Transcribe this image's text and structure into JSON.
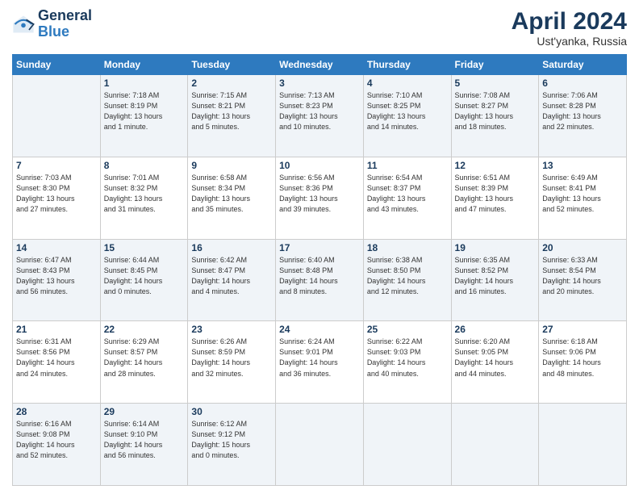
{
  "logo": {
    "line1": "General",
    "line2": "Blue"
  },
  "title": {
    "main": "April 2024",
    "sub": "Ust'yanka, Russia"
  },
  "days_of_week": [
    "Sunday",
    "Monday",
    "Tuesday",
    "Wednesday",
    "Thursday",
    "Friday",
    "Saturday"
  ],
  "weeks": [
    [
      {
        "day": "",
        "info": ""
      },
      {
        "day": "1",
        "info": "Sunrise: 7:18 AM\nSunset: 8:19 PM\nDaylight: 13 hours\nand 1 minute."
      },
      {
        "day": "2",
        "info": "Sunrise: 7:15 AM\nSunset: 8:21 PM\nDaylight: 13 hours\nand 5 minutes."
      },
      {
        "day": "3",
        "info": "Sunrise: 7:13 AM\nSunset: 8:23 PM\nDaylight: 13 hours\nand 10 minutes."
      },
      {
        "day": "4",
        "info": "Sunrise: 7:10 AM\nSunset: 8:25 PM\nDaylight: 13 hours\nand 14 minutes."
      },
      {
        "day": "5",
        "info": "Sunrise: 7:08 AM\nSunset: 8:27 PM\nDaylight: 13 hours\nand 18 minutes."
      },
      {
        "day": "6",
        "info": "Sunrise: 7:06 AM\nSunset: 8:28 PM\nDaylight: 13 hours\nand 22 minutes."
      }
    ],
    [
      {
        "day": "7",
        "info": "Sunrise: 7:03 AM\nSunset: 8:30 PM\nDaylight: 13 hours\nand 27 minutes."
      },
      {
        "day": "8",
        "info": "Sunrise: 7:01 AM\nSunset: 8:32 PM\nDaylight: 13 hours\nand 31 minutes."
      },
      {
        "day": "9",
        "info": "Sunrise: 6:58 AM\nSunset: 8:34 PM\nDaylight: 13 hours\nand 35 minutes."
      },
      {
        "day": "10",
        "info": "Sunrise: 6:56 AM\nSunset: 8:36 PM\nDaylight: 13 hours\nand 39 minutes."
      },
      {
        "day": "11",
        "info": "Sunrise: 6:54 AM\nSunset: 8:37 PM\nDaylight: 13 hours\nand 43 minutes."
      },
      {
        "day": "12",
        "info": "Sunrise: 6:51 AM\nSunset: 8:39 PM\nDaylight: 13 hours\nand 47 minutes."
      },
      {
        "day": "13",
        "info": "Sunrise: 6:49 AM\nSunset: 8:41 PM\nDaylight: 13 hours\nand 52 minutes."
      }
    ],
    [
      {
        "day": "14",
        "info": "Sunrise: 6:47 AM\nSunset: 8:43 PM\nDaylight: 13 hours\nand 56 minutes."
      },
      {
        "day": "15",
        "info": "Sunrise: 6:44 AM\nSunset: 8:45 PM\nDaylight: 14 hours\nand 0 minutes."
      },
      {
        "day": "16",
        "info": "Sunrise: 6:42 AM\nSunset: 8:47 PM\nDaylight: 14 hours\nand 4 minutes."
      },
      {
        "day": "17",
        "info": "Sunrise: 6:40 AM\nSunset: 8:48 PM\nDaylight: 14 hours\nand 8 minutes."
      },
      {
        "day": "18",
        "info": "Sunrise: 6:38 AM\nSunset: 8:50 PM\nDaylight: 14 hours\nand 12 minutes."
      },
      {
        "day": "19",
        "info": "Sunrise: 6:35 AM\nSunset: 8:52 PM\nDaylight: 14 hours\nand 16 minutes."
      },
      {
        "day": "20",
        "info": "Sunrise: 6:33 AM\nSunset: 8:54 PM\nDaylight: 14 hours\nand 20 minutes."
      }
    ],
    [
      {
        "day": "21",
        "info": "Sunrise: 6:31 AM\nSunset: 8:56 PM\nDaylight: 14 hours\nand 24 minutes."
      },
      {
        "day": "22",
        "info": "Sunrise: 6:29 AM\nSunset: 8:57 PM\nDaylight: 14 hours\nand 28 minutes."
      },
      {
        "day": "23",
        "info": "Sunrise: 6:26 AM\nSunset: 8:59 PM\nDaylight: 14 hours\nand 32 minutes."
      },
      {
        "day": "24",
        "info": "Sunrise: 6:24 AM\nSunset: 9:01 PM\nDaylight: 14 hours\nand 36 minutes."
      },
      {
        "day": "25",
        "info": "Sunrise: 6:22 AM\nSunset: 9:03 PM\nDaylight: 14 hours\nand 40 minutes."
      },
      {
        "day": "26",
        "info": "Sunrise: 6:20 AM\nSunset: 9:05 PM\nDaylight: 14 hours\nand 44 minutes."
      },
      {
        "day": "27",
        "info": "Sunrise: 6:18 AM\nSunset: 9:06 PM\nDaylight: 14 hours\nand 48 minutes."
      }
    ],
    [
      {
        "day": "28",
        "info": "Sunrise: 6:16 AM\nSunset: 9:08 PM\nDaylight: 14 hours\nand 52 minutes."
      },
      {
        "day": "29",
        "info": "Sunrise: 6:14 AM\nSunset: 9:10 PM\nDaylight: 14 hours\nand 56 minutes."
      },
      {
        "day": "30",
        "info": "Sunrise: 6:12 AM\nSunset: 9:12 PM\nDaylight: 15 hours\nand 0 minutes."
      },
      {
        "day": "",
        "info": ""
      },
      {
        "day": "",
        "info": ""
      },
      {
        "day": "",
        "info": ""
      },
      {
        "day": "",
        "info": ""
      }
    ]
  ]
}
